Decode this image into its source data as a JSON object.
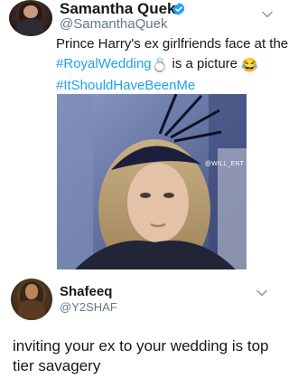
{
  "tweet": {
    "author_name": "Samantha Quek",
    "author_handle": "@SamanthaQuek",
    "verified": true,
    "text_part1": "Prince Harry's ex girlfriends face at the ",
    "hashtag1": "#RoyalWedding",
    "text_part2": " is a picture ",
    "hashtag2": "#ItShouldHaveBeenMe",
    "photo_watermark": "@WILL_ENT",
    "ring_emoji": "💍",
    "laugh_emoji": "😂"
  },
  "reply": {
    "author_name": "Shafeeq",
    "author_handle": "@Y2SHAF",
    "text": "inviting your ex to your wedding is top tier savagery"
  },
  "colors": {
    "text": "#14171a",
    "handle": "#657786",
    "hashtag": "#1da1f2",
    "verified": "#1da1f2"
  },
  "icons": {
    "verified": "verified-badge-icon",
    "more": "chevron-down-icon"
  }
}
